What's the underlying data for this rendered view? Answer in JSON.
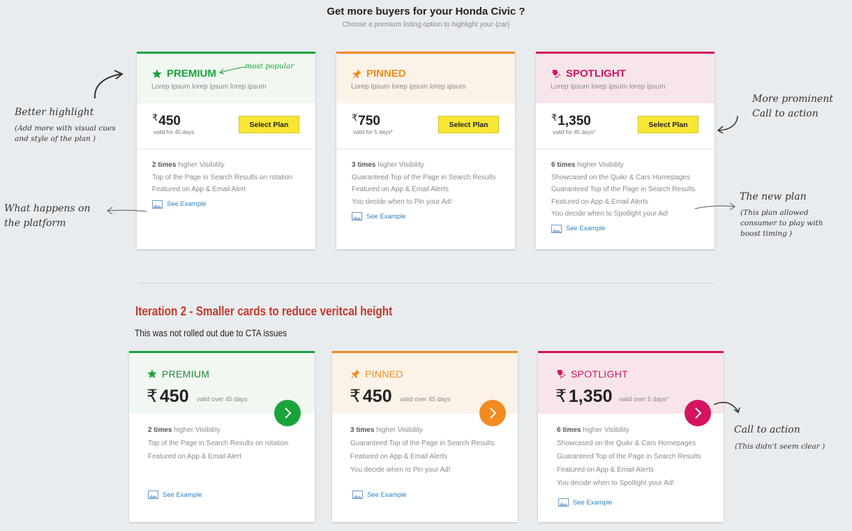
{
  "header": {
    "title": "Get more buyers for your Honda Civic ?",
    "subtitle": "Choose a premium listing option to highlight your {car}"
  },
  "colors": {
    "premium": "#1aa33b",
    "pinned": "#f28b22",
    "spotlight": "#d6135e",
    "select_button": "#f8e635",
    "link": "#2b7fc2",
    "iteration_heading": "#c8372a"
  },
  "plans": [
    {
      "name": "PREMIUM",
      "icon": "star-icon",
      "desc": "Lorep Ipsum lorep ipsum lorep ipsum",
      "currency": "₹",
      "price": "450",
      "valid": "valid for 45 days",
      "button": "Select Plan",
      "features": [
        {
          "strong": "2 times",
          "rest": " higher Visibility"
        },
        {
          "strong": "",
          "rest": "Top of the Page in Search Results on rotation"
        },
        {
          "strong": "",
          "rest": "Featured on App & Email Alert"
        }
      ],
      "example": "See Example",
      "badge": "most popular"
    },
    {
      "name": "PINNED",
      "icon": "pin-icon",
      "desc": "Lorep Ipsum lorep ipsum lorep ipsum",
      "currency": "₹",
      "price": "750",
      "valid": "valid for 5 days*",
      "button": "Select Plan",
      "features": [
        {
          "strong": "3 times",
          "rest": " higher Visibility"
        },
        {
          "strong": "",
          "rest": "Guaranteed Top of the Page in Search Results"
        },
        {
          "strong": "",
          "rest": "Featured on App & Email Alerts"
        },
        {
          "strong": "",
          "rest": "You decide when to Pin your Ad!"
        }
      ],
      "example": "See Example"
    },
    {
      "name": "SPOTLIGHT",
      "icon": "spotlight-icon",
      "desc": "Lorep Ipsum lorep ipsum lorep ipsum",
      "currency": "₹",
      "price": "1,350",
      "valid": "valid for 45 days*",
      "button": "Select Plan",
      "features": [
        {
          "strong": "6 times",
          "rest": " higher Visibility"
        },
        {
          "strong": "",
          "rest": "Showcased on the Quikr & Cars Homepages"
        },
        {
          "strong": "",
          "rest": "Guaranteed Top of the Page in Search Results"
        },
        {
          "strong": "",
          "rest": "Featured on App & Email Alerts"
        },
        {
          "strong": "",
          "rest": "You decide when to Spotlight your Ad!"
        }
      ],
      "example": "See Example"
    }
  ],
  "iteration2": {
    "heading": "Iteration 2 -  Smaller cards  to reduce veritcal height",
    "note": "This was not rolled out due to CTA issues",
    "plans": [
      {
        "name": "PREMIUM",
        "currency": "₹",
        "price": "450",
        "valid": "valid over 45 days",
        "features": [
          {
            "strong": "2 times",
            "rest": " higher Visibility"
          },
          {
            "strong": "",
            "rest": "Top of the Page in Search Results on rotation"
          },
          {
            "strong": "",
            "rest": "Featured on App & Email Alert"
          }
        ],
        "example": "See Example"
      },
      {
        "name": "PINNED",
        "currency": "₹",
        "price": "450",
        "valid": "valid over 45 days",
        "features": [
          {
            "strong": "3 times",
            "rest": " higher Visibility"
          },
          {
            "strong": "",
            "rest": "Guaranteed Top of the Page in Search Results"
          },
          {
            "strong": "",
            "rest": "Featured on App & Email Alerts"
          },
          {
            "strong": "",
            "rest": "You decide when to Pin your Ad!"
          }
        ],
        "example": "See Example"
      },
      {
        "name": "SPOTLIGHT",
        "currency": "₹",
        "price": "1,350",
        "valid": "valid over 5 days*",
        "features": [
          {
            "strong": "6 times",
            "rest": " higher Visibility"
          },
          {
            "strong": "",
            "rest": "Showcased on the Quikr & Cars Homepages"
          },
          {
            "strong": "",
            "rest": "Guaranteed Top of the Page in Search Results"
          },
          {
            "strong": "",
            "rest": "Featured on App & Email Alerts"
          },
          {
            "strong": "",
            "rest": "You decide when to Spotlight your Ad!"
          }
        ],
        "example": "See Example"
      }
    ]
  },
  "annotations": {
    "better_highlight": "Better highlight",
    "better_highlight_note": "(Add more  with visual cues and style of the plan )",
    "platform": "What happens on the platform",
    "prominent": "More prominent Call to action",
    "new_plan": "The new plan",
    "new_plan_note": "(This plan allowed consumer to play with boost timing )",
    "cta": "Call to action",
    "cta_note": "(This didn't seem clear )"
  }
}
